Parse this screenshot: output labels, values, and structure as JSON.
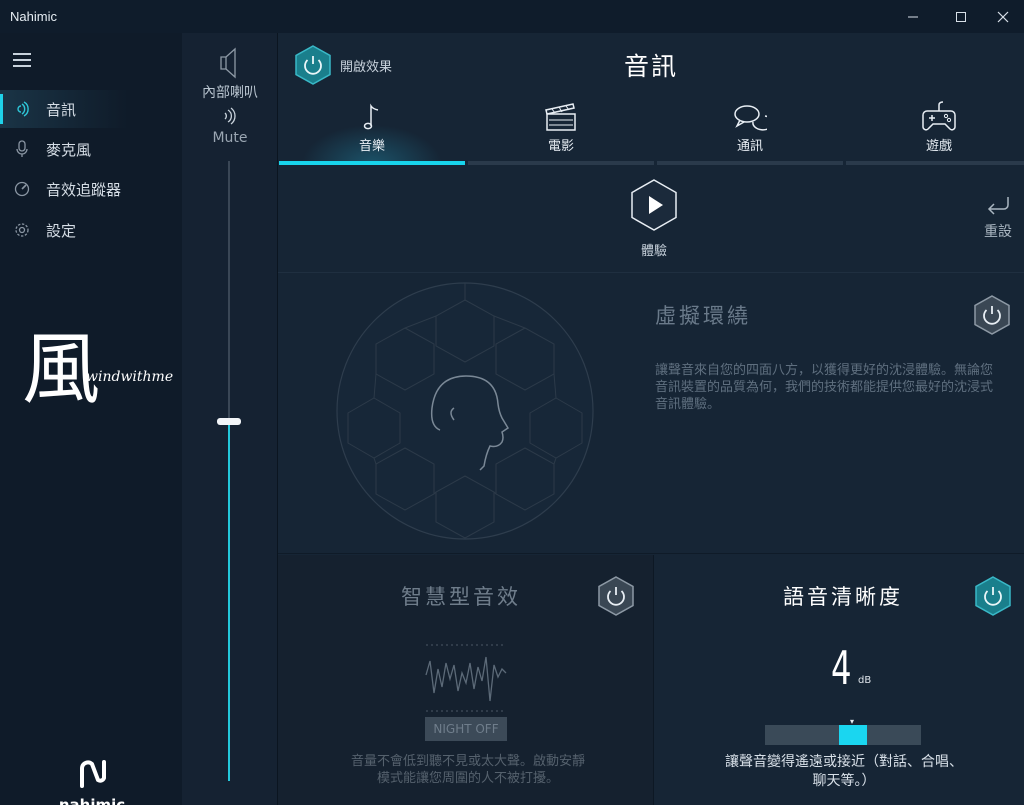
{
  "window": {
    "title": "Nahimic"
  },
  "nav": {
    "items": [
      {
        "label": "音訊",
        "icon": "audio-wave-icon",
        "active": true
      },
      {
        "label": "麥克風",
        "icon": "microphone-icon",
        "active": false
      },
      {
        "label": "音效追蹤器",
        "icon": "tracker-icon",
        "active": false
      },
      {
        "label": "設定",
        "icon": "gear-icon",
        "active": false
      }
    ],
    "watermark_char": "風",
    "watermark_text": "windwithme",
    "brand": "nahimic"
  },
  "volume": {
    "device_label": "內部喇叭",
    "mute_label": "Mute",
    "level_percent": 58
  },
  "header": {
    "power_label": "開啟效果",
    "title": "音訊"
  },
  "tabs": [
    {
      "label": "音樂",
      "icon": "music-note-icon",
      "active": true
    },
    {
      "label": "電影",
      "icon": "clapperboard-icon",
      "active": false
    },
    {
      "label": "通訊",
      "icon": "chat-bubbles-icon",
      "active": false
    },
    {
      "label": "遊戲",
      "icon": "gamepad-icon",
      "active": false
    }
  ],
  "play": {
    "label": "體驗"
  },
  "reset": {
    "label": "重設"
  },
  "surround": {
    "title": "虛擬環繞",
    "description": "讓聲音來自您的四面八方，以獲得更好的沈浸體驗。無論您音訊裝置的品質為何，我們的技術都能提供您最好的沈浸式音訊體驗。"
  },
  "smart": {
    "title": "智慧型音效",
    "night_label": "NIGHT OFF",
    "description": "音量不會低到聽不見或太大聲。啟動安靜模式能讓您周圍的人不被打擾。"
  },
  "voice": {
    "title": "語音清晰度",
    "value": "4",
    "unit": "dB",
    "level_fraction": 0.5,
    "description": "讓聲音變得遙遠或接近（對話、合唱、聊天等。）"
  },
  "colors": {
    "accent": "#18d4ec",
    "background": "#162535",
    "nav_background": "#0f1b29"
  }
}
